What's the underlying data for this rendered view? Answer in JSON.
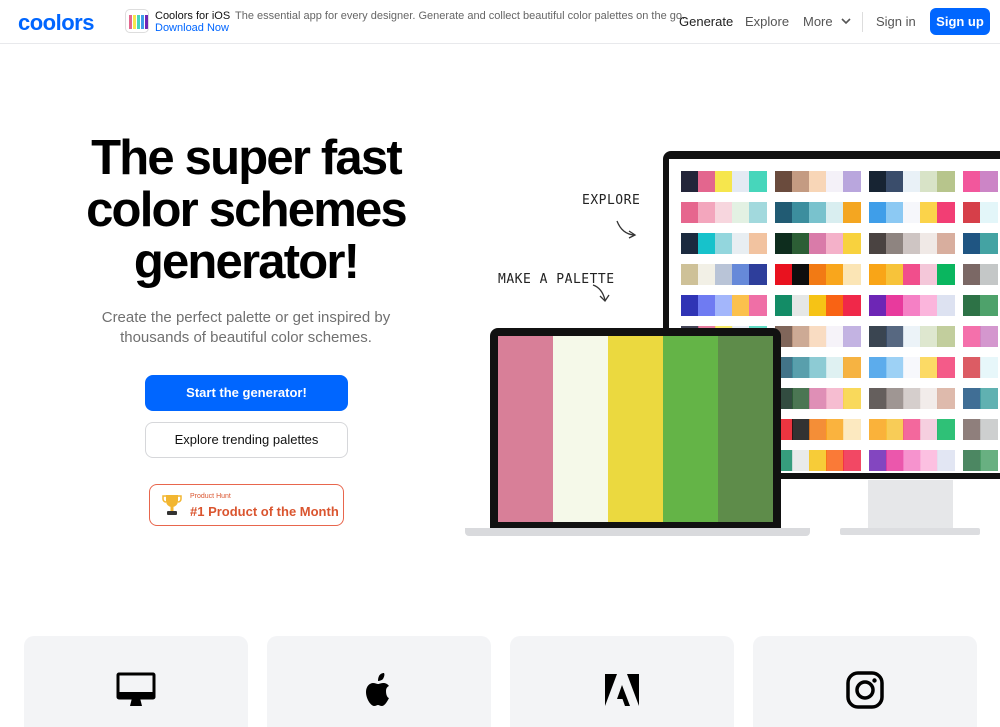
{
  "brand": {
    "logo": "coolors",
    "accent": "#0066ff"
  },
  "promo": {
    "title": "Coolors for iOS",
    "description": "The essential app for every designer. Generate and collect beautiful color palettes on the go.",
    "link": "Download Now"
  },
  "nav": {
    "generate": "Generate",
    "explore": "Explore",
    "more": "More",
    "sign_in": "Sign in",
    "sign_up": "Sign up"
  },
  "hero": {
    "title_line1": "The super fast",
    "title_line2": "color schemes",
    "title_line3": "generator!",
    "subtitle_line1": "Create the perfect palette or get inspired by",
    "subtitle_line2": "thousands of beautiful color schemes.",
    "primary_button": "Start the generator!",
    "secondary_button": "Explore trending palettes"
  },
  "product_hunt": {
    "small": "Product Hunt",
    "big": "#1 Product of the Month"
  },
  "illustration": {
    "explore_label": "EXPLORE",
    "make_label": "MAKE A PALETTE",
    "laptop_palette": [
      "#d87f98",
      "#f5f9e9",
      "#ebd93f",
      "#64b447",
      "#5e8c4a"
    ],
    "monitor_palettes": [
      [
        "#23253a",
        "#e3668e",
        "#f6e64d",
        "#e4eaf3",
        "#47d6bb"
      ],
      [
        "#6a4b3d",
        "#c49b82",
        "#f8d6b7",
        "#f4f1f8",
        "#b9a6dd"
      ],
      [
        "#172433",
        "#3a4d6b",
        "#e9f1f7",
        "#d8e3c7",
        "#b7c58c"
      ],
      [
        "#f2579c",
        "#cc85c6"
      ],
      [
        "#e6668e",
        "#f3a6bd",
        "#f7d6de",
        "#e3f1e3",
        "#a2d9dd"
      ],
      [
        "#215b73",
        "#3c8e9e",
        "#79c2cd",
        "#d9eef0",
        "#f4a621"
      ],
      [
        "#3f9ee9",
        "#8cc9f3",
        "#f6f7fb",
        "#fbd34a",
        "#f23e74"
      ],
      [
        "#d63f49",
        "#e3f6f9"
      ],
      [
        "#1b2a3f",
        "#17c2cb",
        "#93d6dd",
        "#e8eef2",
        "#f2c3a0"
      ],
      [
        "#0e2d1e",
        "#2c5e35",
        "#d97ba9",
        "#f4b1c9",
        "#f8d23e"
      ],
      [
        "#4a4341",
        "#8e8480",
        "#cec5c3",
        "#f0e9e6",
        "#d8ae9e"
      ],
      [
        "#1f5582",
        "#44a3a3"
      ],
      [
        "#cec198",
        "#f2f0e6",
        "#b9c4d7",
        "#6689d9",
        "#2e3e9b"
      ],
      [
        "#e9121f",
        "#0e0e0e",
        "#f27a14",
        "#f9a61c",
        "#fbe5b5"
      ],
      [
        "#f9a517",
        "#f7c33a",
        "#f14e8c",
        "#f4c7d9",
        "#0ab65f"
      ],
      [
        "#7b6865",
        "#c4c7c7"
      ],
      [
        "#3034b5",
        "#6f7bf2",
        "#a3b6fb",
        "#fbc14d",
        "#ef6fa6"
      ],
      [
        "#138c66",
        "#e5e7e6",
        "#f6c315",
        "#f96314",
        "#f02849"
      ],
      [
        "#6d26b5",
        "#e83a9d",
        "#f580c5",
        "#fbb5dc",
        "#dde2f1"
      ],
      [
        "#2d7246",
        "#4ea26b"
      ]
    ]
  },
  "features": {
    "icons": [
      "desktop-icon",
      "apple-icon",
      "adobe-icon",
      "instagram-icon"
    ]
  }
}
